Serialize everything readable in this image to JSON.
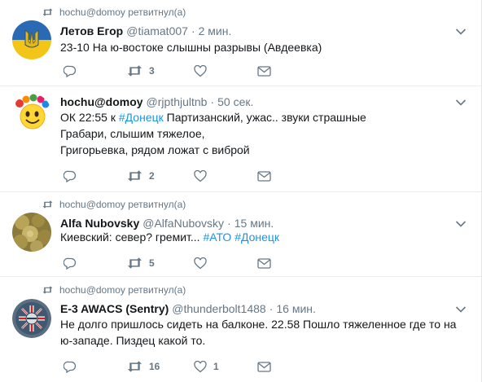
{
  "tweets": [
    {
      "retweeted_by": "hochu@domoy ретвитнул(а)",
      "name": "Летов Егор",
      "handle": "@tiamat007",
      "time": "2 мин.",
      "lines": [
        [
          "23-10 На ю-востоке слышны разрывы (Авдеевка)"
        ]
      ],
      "reply_count": "",
      "retweet_count": "3",
      "like_count": "",
      "avatar_icon": "ukraine-coat-of-arms-avatar"
    },
    {
      "retweeted_by": "",
      "name": "hochu@domoy",
      "handle": "@rjpthjultnb",
      "time": "50 сек.",
      "line1_a": "ОК 22:55 к ",
      "line1_tag": "#Донецк",
      "line1_b": " Партизанский, ужас.. звуки страшные",
      "line2": "Грабари, слышим тяжелое,",
      "line3": "Григорьевка, рядом ложат с виброй",
      "reply_count": "",
      "retweet_count": "2",
      "like_count": "",
      "avatar_icon": "smiley-flower-avatar"
    },
    {
      "retweeted_by": "hochu@domoy ретвитнул(а)",
      "name": "Alfa Nubovsky",
      "handle": "@AlfaNubovsky",
      "time": "15 мин.",
      "line1_a": "Киевский: север? гремит... ",
      "tag1": "#АТО",
      "tag2": "#Донецк",
      "reply_count": "",
      "retweet_count": "5",
      "like_count": "",
      "avatar_icon": "gold-texture-avatar"
    },
    {
      "retweeted_by": "hochu@domoy ретвитнул(а)",
      "name": "E-3 AWACS (Sentry)",
      "handle": "@thunderbolt1488",
      "time": "16 мин.",
      "line1": "Не долго пришлось сидеть на балконе. 22.58 Пошло тяжеленное где то на",
      "line2": "ю-западе. Пиздец какой то.",
      "reply_count": "",
      "retweet_count": "16",
      "like_count": "1",
      "avatar_icon": "awacs-roundel-avatar"
    }
  ],
  "colors": {
    "link": "#1b95e0",
    "secondary": "#657786",
    "text": "#14171a"
  }
}
